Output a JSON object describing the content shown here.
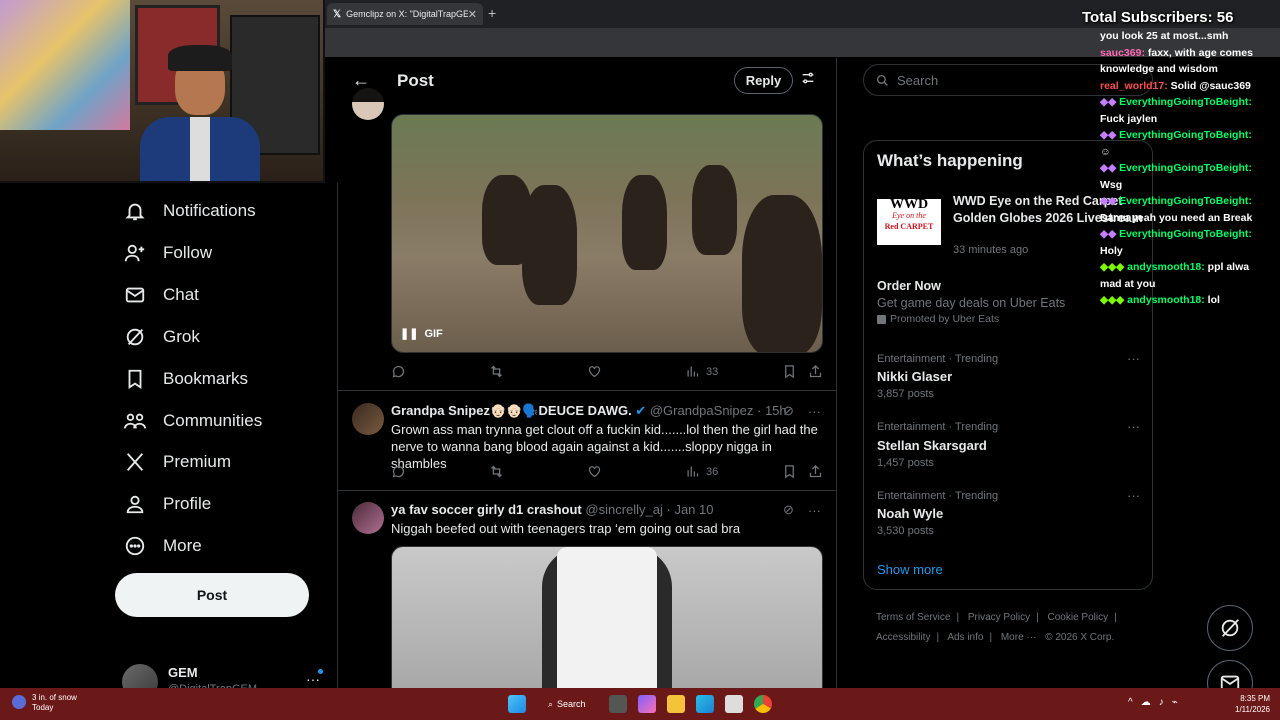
{
  "browser": {
    "tab_title": "Gemclipz on X: \"DigitalTrapGEM",
    "tab_close": "✕",
    "new_tab": "+"
  },
  "overlay": {
    "subscribers": "Total Subscribers: 56"
  },
  "sidebar": {
    "items": [
      {
        "label": "Notifications"
      },
      {
        "label": "Follow"
      },
      {
        "label": "Chat"
      },
      {
        "label": "Grok"
      },
      {
        "label": "Bookmarks"
      },
      {
        "label": "Communities"
      },
      {
        "label": "Premium"
      },
      {
        "label": "Profile"
      },
      {
        "label": "More"
      }
    ],
    "post_label": "Post",
    "account_name": "GEM",
    "account_handle": "@DigitalTrapGEM"
  },
  "header": {
    "title": "Post",
    "reply_label": "Reply"
  },
  "posts": [
    {
      "gif_label": "GIF",
      "views": "33"
    },
    {
      "name": "Grandpa Snipez👴🏻👴🏻🗣️DEUCE DAWG.",
      "handle": "@GrandpaSnipez · 15h",
      "text": "Grown ass man trynna get clout off a fuckin kid.......lol then the girl had the nerve to wanna bang blood again against a kid.......sloppy nigga in shambles",
      "views": "36"
    },
    {
      "name": "ya fav soccer girly d1 crashout",
      "handle": "@sincrelly_aj · Jan 10",
      "text": "Niggah beefed out with teenagers trap ‘em going out sad bra"
    }
  ],
  "right": {
    "search_placeholder": "Search",
    "section_title": "What’s happening",
    "featured": {
      "logo_line1": "WWD",
      "logo_line2": "Eye on the",
      "logo_line3": "Red CARPET",
      "title": "WWD Eye on the Red Carpet Golden Globes 2026 Livestream",
      "time": "33 minutes ago"
    },
    "promo": {
      "title": "Order Now",
      "subtitle": "Get game day deals on Uber Eats",
      "promoted": "Promoted by Uber Eats"
    },
    "trends": [
      {
        "label": "Entertainment · Trending",
        "name": "Nikki Glaser",
        "posts": "3,857 posts"
      },
      {
        "label": "Entertainment · Trending",
        "name": "Stellan Skarsgard",
        "posts": "1,457 posts"
      },
      {
        "label": "Entertainment · Trending",
        "name": "Noah Wyle",
        "posts": "3,530 posts"
      }
    ],
    "show_more": "Show more",
    "footer": [
      "Terms of Service",
      "|",
      "Privacy Policy",
      "|",
      "Cookie Policy",
      "|",
      "Accessibility",
      "|",
      "Ads info",
      "|",
      "More ···",
      "© 2026 X Corp."
    ]
  },
  "chat": [
    {
      "user": "",
      "text": "you look 25 at most...smh",
      "color": "#ffffff"
    },
    {
      "user": "sauc369:",
      "text": " faxx, with age comes",
      "color": "#ff69b4"
    },
    {
      "user": "",
      "text": "knowledge and wisdom",
      "color": "#ffffff"
    },
    {
      "user": "real_world17:",
      "text": " Solid @sauc369",
      "color": "#ff4d4d"
    },
    {
      "user": "EverythingGoingToBeight:",
      "text": "",
      "color": "#00ff66"
    },
    {
      "user": "",
      "text": "Fuck jaylen",
      "color": "#ffffff"
    },
    {
      "user": "EverythingGoingToBeight:",
      "text": "",
      "color": "#00ff66"
    },
    {
      "user": "",
      "text": "",
      "color": "#ffffff"
    },
    {
      "user": "EverythingGoingToBeight:",
      "text": "",
      "color": "#00ff66"
    },
    {
      "user": "",
      "text": "Wsg",
      "color": "#ffffff"
    },
    {
      "user": "EverythingGoingToBeight:",
      "text": "",
      "color": "#00ff66"
    },
    {
      "user": "",
      "text": "Damn yeah you need an Break",
      "color": "#ffffff"
    },
    {
      "user": "EverythingGoingToBeight:",
      "text": "",
      "color": "#00ff66"
    },
    {
      "user": "",
      "text": "Holy",
      "color": "#ffffff"
    },
    {
      "user": "andysmooth18:",
      "text": " ppl alwa",
      "color": "#00ff66"
    },
    {
      "user": "",
      "text": "mad at you",
      "color": "#ffffff"
    },
    {
      "user": "andysmooth18:",
      "text": " lol",
      "color": "#00ff66"
    }
  ],
  "taskbar": {
    "weather": "3 in. of snow",
    "weather_sub": "Today",
    "search": "Search",
    "time": "8:35 PM",
    "date": "1/11/2026"
  },
  "colors": {
    "accent": "#1d9bf0",
    "taskbar": "#6b1818",
    "wwd_red": "#d4121c"
  }
}
